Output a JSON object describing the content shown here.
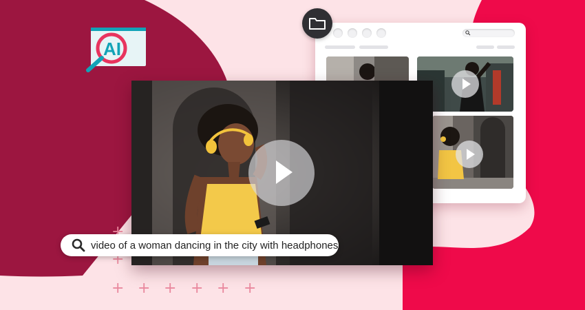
{
  "logo": {
    "text": "AI",
    "icon": "magnifier-ai-logo"
  },
  "folder": {
    "icon": "folder-icon"
  },
  "browser": {
    "window_dots": 4,
    "search_icon": "search-icon",
    "thumbnails": [
      {
        "label": "video-thumbnail-1",
        "has_play": false
      },
      {
        "label": "video-thumbnail-2",
        "has_play": true
      },
      {
        "label": "video-thumbnail-3",
        "has_play": true
      }
    ]
  },
  "main_video": {
    "play_icon": "play-icon"
  },
  "search": {
    "query": "video of a woman dancing in the city with headphones",
    "icon": "search-icon"
  },
  "colors": {
    "crimson": "#9c1640",
    "red": "#ef0a4a",
    "pink_bg": "#fde3e7",
    "teal": "#12a3b7",
    "pink_accent": "#e8345e"
  }
}
